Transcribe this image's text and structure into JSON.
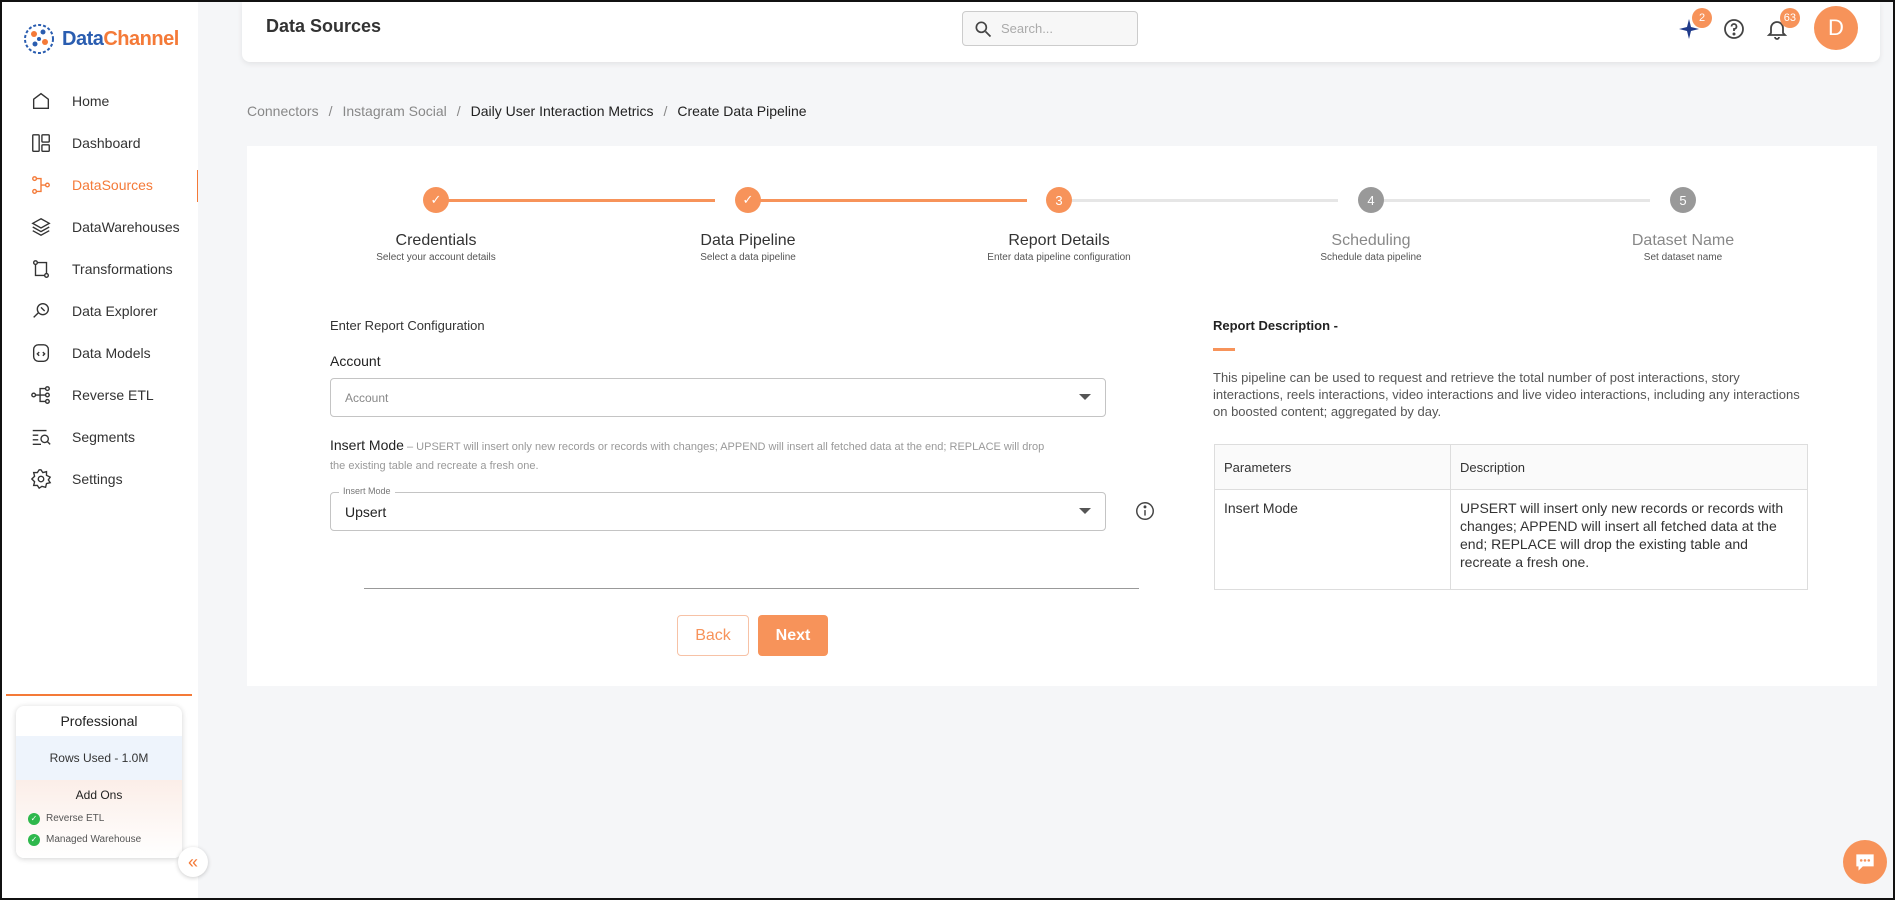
{
  "brand": {
    "part1": "Data",
    "part2": "Channel"
  },
  "sidebar": {
    "items": [
      {
        "label": "Home",
        "icon": "home-icon"
      },
      {
        "label": "Dashboard",
        "icon": "dashboard-icon"
      },
      {
        "label": "DataSources",
        "icon": "datasources-icon",
        "active": true
      },
      {
        "label": "DataWarehouses",
        "icon": "layers-icon"
      },
      {
        "label": "Transformations",
        "icon": "transform-icon"
      },
      {
        "label": "Data Explorer",
        "icon": "explorer-icon"
      },
      {
        "label": "Data Models",
        "icon": "models-icon"
      },
      {
        "label": "Reverse ETL",
        "icon": "reverse-etl-icon"
      },
      {
        "label": "Segments",
        "icon": "segments-icon"
      },
      {
        "label": "Settings",
        "icon": "gear-icon"
      }
    ],
    "plan": {
      "name": "Professional",
      "rows_used": "Rows Used - 1.0M",
      "addons_title": "Add Ons",
      "addons": [
        "Reverse ETL",
        "Managed Warehouse"
      ]
    }
  },
  "header": {
    "title": "Data Sources",
    "search_placeholder": "Search...",
    "sparkle_badge": "2",
    "notification_badge": "63",
    "avatar_initial": "D"
  },
  "breadcrumb": [
    "Connectors",
    "Instagram Social",
    "Daily User Interaction Metrics",
    "Create Data Pipeline"
  ],
  "stepper": {
    "current_step": 3,
    "steps": [
      {
        "marker": "✓",
        "title": "Credentials",
        "subtitle": "Select your account details"
      },
      {
        "marker": "✓",
        "title": "Data Pipeline",
        "subtitle": "Select a data pipeline"
      },
      {
        "marker": "3",
        "title": "Report Details",
        "subtitle": "Enter data pipeline configuration"
      },
      {
        "marker": "4",
        "title": "Scheduling",
        "subtitle": "Schedule data pipeline"
      },
      {
        "marker": "5",
        "title": "Dataset Name",
        "subtitle": "Set dataset name"
      }
    ]
  },
  "form": {
    "heading": "Enter Report Configuration",
    "account_label": "Account",
    "account_placeholder": "Account",
    "insert_mode_label": "Insert Mode",
    "insert_mode_desc": " – UPSERT will insert only new records or records with changes; APPEND will insert all fetched data at the end; REPLACE will drop the existing table and recreate a fresh one.",
    "insert_mode_floating": "Insert Mode",
    "insert_mode_value": "Upsert",
    "back_label": "Back",
    "next_label": "Next"
  },
  "report": {
    "title": "Report Description -",
    "description": "This pipeline can be used to request and retrieve the total number of post interactions, story interactions, reels interactions, video interactions and live video interactions, including any interactions on boosted content; aggregated by day.",
    "table_headers": [
      "Parameters",
      "Description"
    ],
    "rows": [
      {
        "param": "Insert Mode",
        "desc": "UPSERT will insert only new records or records with changes; APPEND will insert all fetched data at the end; REPLACE will drop the existing table and recreate a fresh one."
      }
    ]
  },
  "colors": {
    "accent": "#f47a38",
    "accent_light": "#f7935a",
    "muted_step": "#999999",
    "success": "#2eb84c"
  }
}
